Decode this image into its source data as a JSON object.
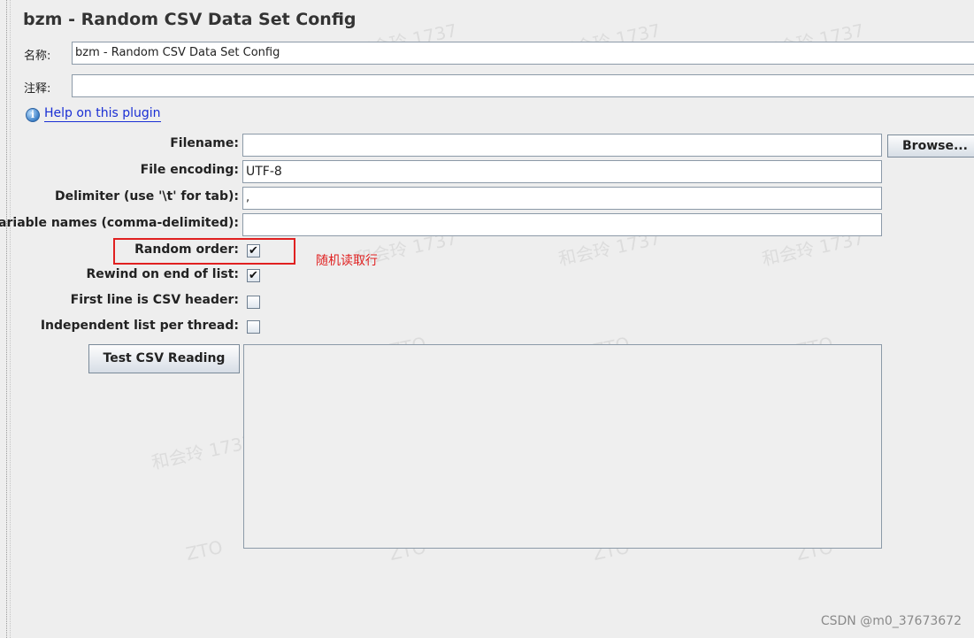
{
  "title": "bzm - Random CSV Data Set Config",
  "name_field": {
    "label": "名称:",
    "value": "bzm - Random CSV Data Set Config"
  },
  "comment_field": {
    "label": "注释:",
    "value": ""
  },
  "help": {
    "icon": "info-icon",
    "link_text": "Help on this plugin"
  },
  "form": {
    "filename_label": "Filename:",
    "filename_value": "",
    "browse_label": "Browse...",
    "encoding_label": "File encoding:",
    "encoding_value": "UTF-8",
    "delimiter_label": "Delimiter (use '\\t' for tab):",
    "delimiter_value": ",",
    "varnames_label": "Variable names (comma-delimited):",
    "varnames_value": "",
    "random_order_label": "Random order:",
    "random_order_checked": true,
    "rewind_label": "Rewind on end of list:",
    "rewind_checked": true,
    "header_label": "First line is CSV header:",
    "header_checked": false,
    "independent_label": "Independent list per thread:",
    "independent_checked": false,
    "test_button_label": "Test CSV Reading"
  },
  "check_glyph": "✔",
  "annotation": {
    "text": "随机读取行",
    "color": "#e02020"
  },
  "watermarks": {
    "name": "和会玲 1737",
    "code": "ZTO"
  },
  "credit": "CSDN @m0_37673672"
}
